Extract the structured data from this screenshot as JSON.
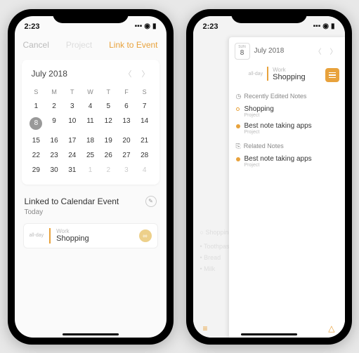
{
  "status": {
    "time": "2:23",
    "signal": "▪▪▪",
    "wifi": "◉",
    "battery": "▮"
  },
  "phone1": {
    "nav": {
      "cancel": "Cancel",
      "title": "Project",
      "action": "Link to Event"
    },
    "calendar": {
      "month_label": "July 2018",
      "dow": [
        "S",
        "M",
        "T",
        "W",
        "T",
        "F",
        "S"
      ],
      "weeks": [
        [
          {
            "n": "1",
            "faded": false
          },
          {
            "n": "2",
            "faded": false
          },
          {
            "n": "3",
            "faded": false
          },
          {
            "n": "4",
            "faded": false
          },
          {
            "n": "5",
            "faded": false
          },
          {
            "n": "6",
            "faded": false
          },
          {
            "n": "7",
            "faded": false
          }
        ],
        [
          {
            "n": "8",
            "faded": false,
            "selected": true
          },
          {
            "n": "9",
            "faded": false
          },
          {
            "n": "10",
            "faded": false
          },
          {
            "n": "11",
            "faded": false
          },
          {
            "n": "12",
            "faded": false
          },
          {
            "n": "13",
            "faded": false
          },
          {
            "n": "14",
            "faded": false
          }
        ],
        [
          {
            "n": "15",
            "faded": false
          },
          {
            "n": "16",
            "faded": false
          },
          {
            "n": "17",
            "faded": false
          },
          {
            "n": "18",
            "faded": false
          },
          {
            "n": "19",
            "faded": false
          },
          {
            "n": "20",
            "faded": false
          },
          {
            "n": "21",
            "faded": false
          }
        ],
        [
          {
            "n": "22",
            "faded": false
          },
          {
            "n": "23",
            "faded": false
          },
          {
            "n": "24",
            "faded": false
          },
          {
            "n": "25",
            "faded": false
          },
          {
            "n": "26",
            "faded": false
          },
          {
            "n": "27",
            "faded": false
          },
          {
            "n": "28",
            "faded": false
          }
        ],
        [
          {
            "n": "29",
            "faded": false
          },
          {
            "n": "30",
            "faded": false
          },
          {
            "n": "31",
            "faded": false
          },
          {
            "n": "1",
            "faded": true
          },
          {
            "n": "2",
            "faded": true
          },
          {
            "n": "3",
            "faded": true
          },
          {
            "n": "4",
            "faded": true
          }
        ]
      ]
    },
    "linked_section": {
      "header": "Linked to Calendar Event",
      "subhead": "Today",
      "event": {
        "allday": "all-day",
        "category": "Work",
        "title": "Shopping"
      }
    }
  },
  "phone2": {
    "panel": {
      "date_badge": {
        "dow": "SUN",
        "num": "8"
      },
      "month_label": "July 2018",
      "event": {
        "allday": "all-day",
        "category": "Work",
        "title": "Shopping"
      },
      "sections": [
        {
          "title": "Recently Edited Notes",
          "items": [
            {
              "dot": "open",
              "title": "Shopping",
              "sub": "Project"
            },
            {
              "dot": "filled",
              "title": "Best note taking apps",
              "sub": "Project"
            }
          ]
        },
        {
          "title": "Related Notes",
          "items": [
            {
              "dot": "filled",
              "title": "Best note taking apps",
              "sub": "Project"
            }
          ]
        }
      ]
    },
    "ghost_heading": "Shopping",
    "ghost_items": [
      "Toothpaste",
      "Bread",
      "Milk"
    ]
  }
}
